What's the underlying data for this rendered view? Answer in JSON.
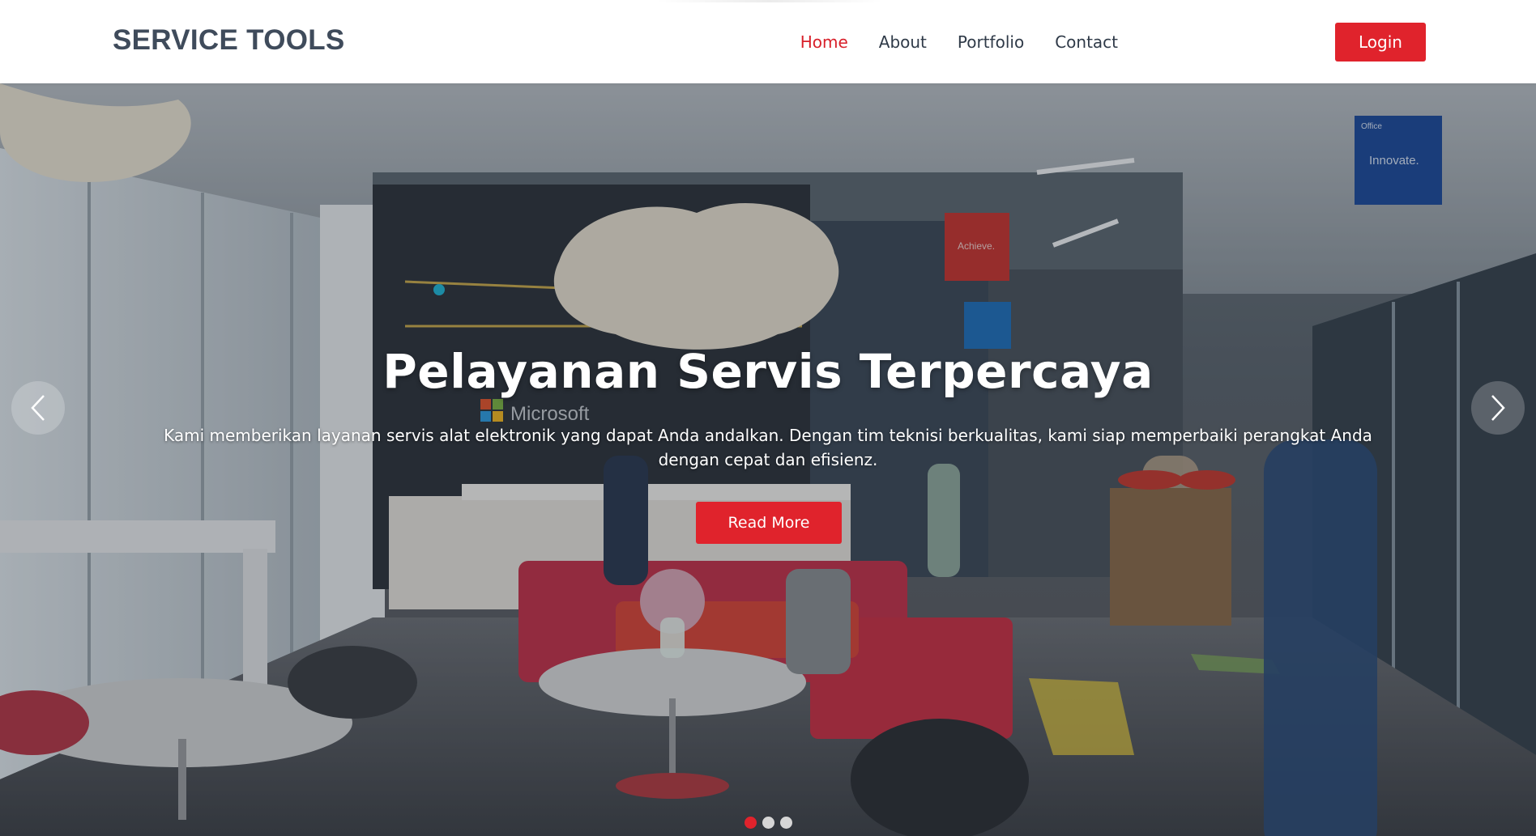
{
  "brand": {
    "name": "SERVICE TOOLS"
  },
  "nav": {
    "items": [
      {
        "label": "Home",
        "active": true
      },
      {
        "label": "About",
        "active": false
      },
      {
        "label": "Portfolio",
        "active": false
      },
      {
        "label": "Contact",
        "active": false
      }
    ],
    "login_label": "Login"
  },
  "hero": {
    "title": "Pelayanan Servis Terpercaya",
    "description": "Kami memberikan layanan servis alat elektronik yang dapat Anda andalkan. Dengan tim teknisi berkualitas, kami siap memperbaiki perangkat Anda dengan cepat dan efisienz.",
    "button_label": "Read More",
    "scene_signs": {
      "brand_sign": "Microsoft",
      "banner_red": "Achieve.",
      "banner_blue": "Innovate.",
      "banner_brand": "Office"
    }
  },
  "carousel": {
    "slide_count": 3,
    "active_index": 0
  },
  "colors": {
    "accent": "#e0232c",
    "brand_text": "#3f4b5b",
    "nav_text": "#2f3a48",
    "white": "#ffffff"
  },
  "icons": {
    "prev": "chevron-left-icon",
    "next": "chevron-right-icon"
  }
}
